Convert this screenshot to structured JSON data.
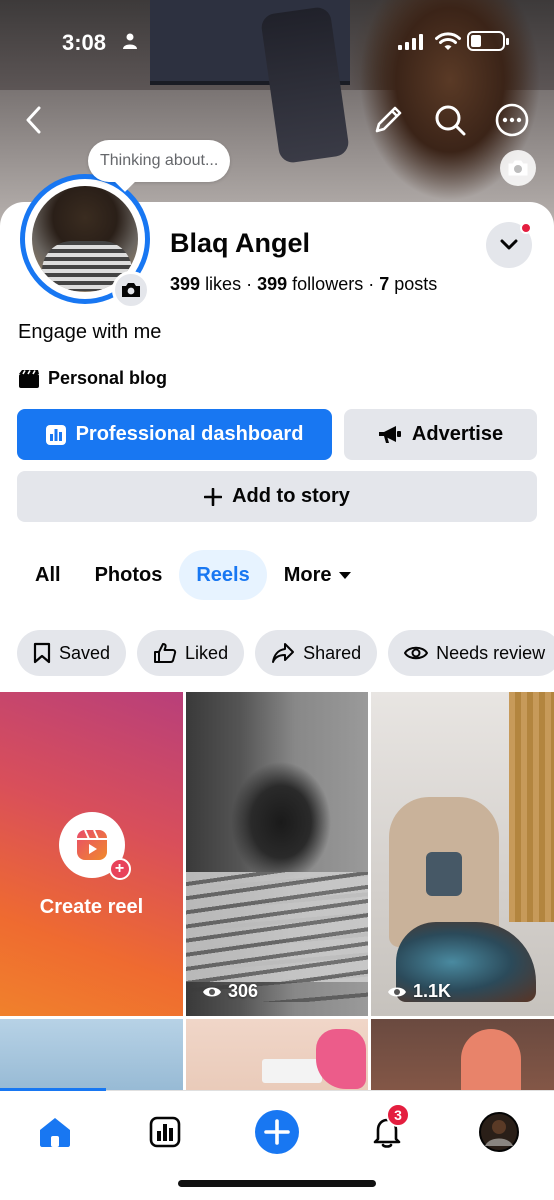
{
  "status_bar": {
    "time": "3:08"
  },
  "profile": {
    "note": "Thinking about...",
    "name": "Blaq Angel",
    "likes_count": "399",
    "likes_label": "likes",
    "followers_count": "399",
    "followers_label": "followers",
    "posts_count": "7",
    "posts_label": "posts",
    "separator": "·",
    "bio": "Engage with me",
    "category": "Personal blog"
  },
  "actions": {
    "dashboard_label": "Professional dashboard",
    "advertise_label": "Advertise",
    "add_story_label": "Add to story"
  },
  "tabs": [
    {
      "label": "All",
      "active": false
    },
    {
      "label": "Photos",
      "active": false
    },
    {
      "label": "Reels",
      "active": true
    },
    {
      "label": "More",
      "active": false
    }
  ],
  "filters": [
    {
      "label": "Saved",
      "icon": "bookmark-icon"
    },
    {
      "label": "Liked",
      "icon": "thumbs-up-icon"
    },
    {
      "label": "Shared",
      "icon": "share-icon"
    },
    {
      "label": "Needs review",
      "icon": "eye-icon"
    }
  ],
  "reels": {
    "create_label": "Create reel",
    "items": [
      {
        "views": "306"
      },
      {
        "views": "1.1K"
      }
    ]
  },
  "bottom_nav": {
    "notifications_badge": "3",
    "items": [
      "home-icon",
      "dashboard-icon",
      "create-icon",
      "notifications-icon",
      "profile-avatar"
    ]
  },
  "colors": {
    "accent": "#1877f2",
    "accent_light": "#e7f3ff",
    "button_gray": "#e4e6eb",
    "badge_red": "#e41e3f"
  }
}
